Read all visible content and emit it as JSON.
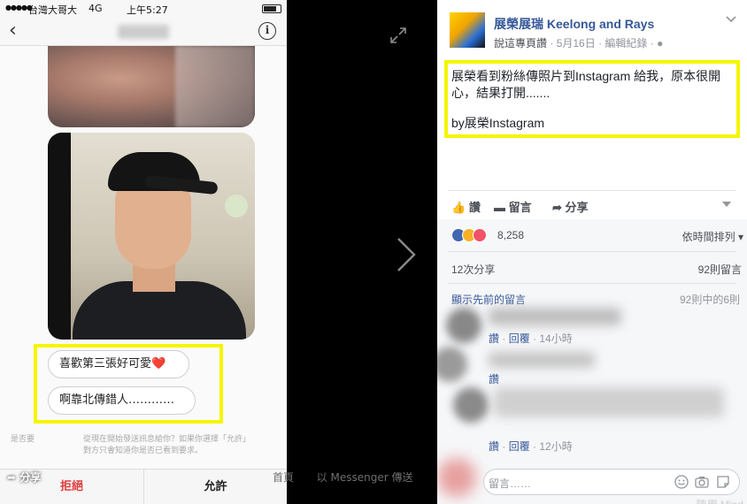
{
  "status_bar": {
    "carrier": "台灣大哥大",
    "network": "4G",
    "time": "上午5:27"
  },
  "messenger": {
    "quick_replies": [
      {
        "text": "喜歡第三張好可愛",
        "emoji": "❤️"
      },
      {
        "text": "啊靠北傳錯人…………"
      }
    ],
    "consent_line1_left": "是否要",
    "consent_line1_right": "從現在開始發送訊息給你？如果你選擇「允許」",
    "consent_line2": "對方只會知道你是否已看到要求。",
    "reject_label": "拒絕",
    "allow_label": "允許",
    "share_overlay": "分享"
  },
  "viewer": {
    "caption_left": "首頁",
    "caption_right": "以 Messenger 傳送"
  },
  "post": {
    "page_name": "展榮展瑞 Keelong and Rays",
    "meta_relation": "說這專頁讚",
    "meta_date": "5月16日",
    "meta_edit": "編輯紀錄",
    "text_line1": "展榮看到粉絲傳照片到Instagram 給我，原本很開心，結果打開.......",
    "text_line2": "by展榮Instagram",
    "actions": {
      "like": "讚",
      "comment": "留言",
      "share": "分享"
    },
    "reactions_count": "8,258",
    "sort_label": "依時間排列",
    "shares": "12次分享",
    "comments_count": "92則留言",
    "prev_comments": "顯示先前的留言",
    "of_count": "92則中的6則",
    "comment_meta": [
      {
        "like": "讚",
        "reply": "回覆",
        "time": "14小時"
      },
      {
        "like": "讚"
      },
      {
        "like": "讚",
        "reply": "回覆",
        "time": "12小時"
      }
    ],
    "reply_placeholder": "留言……",
    "bottom_text": "陸用 Mind"
  },
  "colors": {
    "highlight": "#f5f500",
    "fb_blue": "#365899",
    "reject": "#e03c3c"
  }
}
